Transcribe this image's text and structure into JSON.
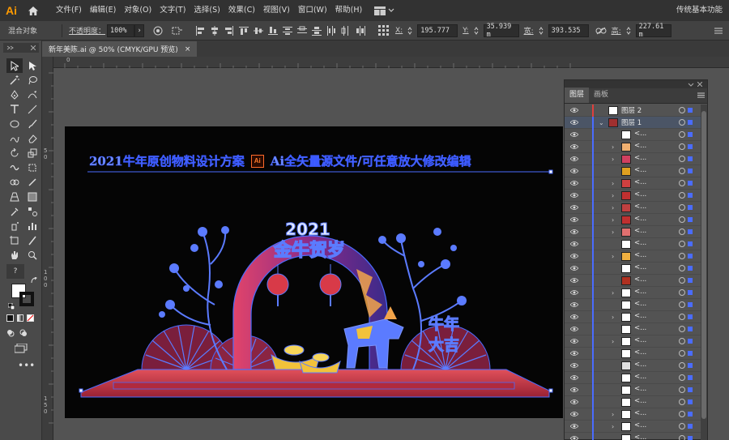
{
  "app": {
    "logo": "Ai"
  },
  "menu": [
    "文件(F)",
    "编辑(E)",
    "对象(O)",
    "文字(T)",
    "选择(S)",
    "效果(C)",
    "视图(V)",
    "窗口(W)",
    "帮助(H)"
  ],
  "workspace": "传统基本功能",
  "control": {
    "mode": "混合对象",
    "opacity_label": "不透明度：",
    "opacity": "100%",
    "x_label": "X:",
    "x": "195.777",
    "y_label": "Y:",
    "y": "35.939 m",
    "w_label": "宽:",
    "w": "393.535",
    "h_label": "高:",
    "h": "227.61 m"
  },
  "document": {
    "tab": "新年美陈.ai @ 50% (CMYK/GPU 预览)",
    "close": "×"
  },
  "rulers": {
    "top": [
      "0"
    ],
    "left": [
      "5 0",
      "1 0 0",
      "1 5 0"
    ]
  },
  "artwork": {
    "headline": "2021牛年原创物料设计方案",
    "badge": "Ai",
    "subline": "Ai全矢量源文件/可任意放大修改编辑",
    "arch_year": "2021",
    "arch_title": "金牛贺岁",
    "side_text_1": "牛年",
    "side_text_2": "大吉"
  },
  "layers": {
    "tabs": [
      "图层",
      "画板"
    ],
    "rows": [
      {
        "name": "图层 2",
        "stripe": "#e0403c",
        "thumb": "#ffffff",
        "expand": "",
        "level": 0,
        "selected": false
      },
      {
        "name": "图层 1",
        "stripe": "#4a6cff",
        "thumb": "#a03030",
        "expand": "⌄",
        "level": 0,
        "selected": true
      },
      {
        "name": "<...",
        "stripe": "#4a6cff",
        "thumb": "#ffffff",
        "expand": "",
        "level": 1,
        "selected": false
      },
      {
        "name": "<...",
        "stripe": "#4a6cff",
        "thumb": "#f0b070",
        "expand": "›",
        "level": 1,
        "selected": false
      },
      {
        "name": "<...",
        "stripe": "#4a6cff",
        "thumb": "#d04060",
        "expand": "›",
        "level": 1,
        "selected": false
      },
      {
        "name": "<...",
        "stripe": "#4a6cff",
        "thumb": "#e0a020",
        "expand": "",
        "level": 1,
        "selected": false
      },
      {
        "name": "<...",
        "stripe": "#4a6cff",
        "thumb": "#d04040",
        "expand": "›",
        "level": 1,
        "selected": false
      },
      {
        "name": "<...",
        "stripe": "#4a6cff",
        "thumb": "#c03030",
        "expand": "›",
        "level": 1,
        "selected": false
      },
      {
        "name": "<...",
        "stripe": "#4a6cff",
        "thumb": "#c04040",
        "expand": "›",
        "level": 1,
        "selected": false
      },
      {
        "name": "<...",
        "stripe": "#4a6cff",
        "thumb": "#c03030",
        "expand": "›",
        "level": 1,
        "selected": false
      },
      {
        "name": "<...",
        "stripe": "#4a6cff",
        "thumb": "#e07070",
        "expand": "›",
        "level": 1,
        "selected": false
      },
      {
        "name": "<...",
        "stripe": "#4a6cff",
        "thumb": "#ffffff",
        "expand": "",
        "level": 1,
        "selected": false
      },
      {
        "name": "<...",
        "stripe": "#4a6cff",
        "thumb": "#f0b040",
        "expand": "›",
        "level": 1,
        "selected": false
      },
      {
        "name": "<...",
        "stripe": "#4a6cff",
        "thumb": "#ffffff",
        "expand": "",
        "level": 1,
        "selected": false
      },
      {
        "name": "<...",
        "stripe": "#4a6cff",
        "thumb": "#b03020",
        "expand": "",
        "level": 1,
        "selected": false
      },
      {
        "name": "<...",
        "stripe": "#4a6cff",
        "thumb": "#ffffff",
        "expand": "›",
        "level": 1,
        "selected": false
      },
      {
        "name": "<...",
        "stripe": "#4a6cff",
        "thumb": "#ffffff",
        "expand": "",
        "level": 1,
        "selected": false
      },
      {
        "name": "<...",
        "stripe": "#4a6cff",
        "thumb": "#ffffff",
        "expand": "›",
        "level": 1,
        "selected": false
      },
      {
        "name": "<...",
        "stripe": "#4a6cff",
        "thumb": "#ffffff",
        "expand": "",
        "level": 1,
        "selected": false
      },
      {
        "name": "<...",
        "stripe": "#4a6cff",
        "thumb": "#ffffff",
        "expand": "›",
        "level": 1,
        "selected": false
      },
      {
        "name": "<...",
        "stripe": "#4a6cff",
        "thumb": "#ffffff",
        "expand": "",
        "level": 1,
        "selected": false
      },
      {
        "name": "<...",
        "stripe": "#4a6cff",
        "thumb": "#e0e0e0",
        "expand": "",
        "level": 1,
        "selected": false
      },
      {
        "name": "<...",
        "stripe": "#4a6cff",
        "thumb": "#ffffff",
        "expand": "",
        "level": 1,
        "selected": false
      },
      {
        "name": "<...",
        "stripe": "#4a6cff",
        "thumb": "#ffffff",
        "expand": "",
        "level": 1,
        "selected": false
      },
      {
        "name": "<...",
        "stripe": "#4a6cff",
        "thumb": "#ffffff",
        "expand": "",
        "level": 1,
        "selected": false
      },
      {
        "name": "<...",
        "stripe": "#4a6cff",
        "thumb": "#ffffff",
        "expand": "›",
        "level": 1,
        "selected": false
      },
      {
        "name": "<...",
        "stripe": "#4a6cff",
        "thumb": "#ffffff",
        "expand": "›",
        "level": 1,
        "selected": false
      },
      {
        "name": "<...",
        "stripe": "#4a6cff",
        "thumb": "#ffffff",
        "expand": "",
        "level": 1,
        "selected": false
      }
    ]
  },
  "colors": {
    "selection": "#4a6cff",
    "accent": "#ff9a00"
  }
}
